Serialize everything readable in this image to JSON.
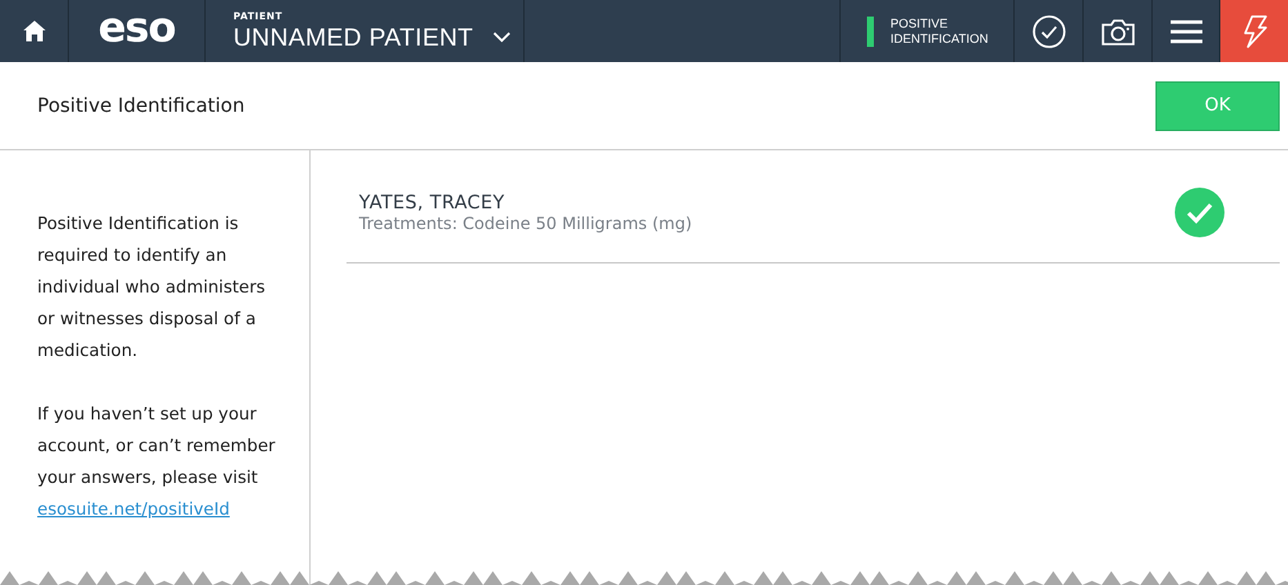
{
  "header": {
    "logo": "eso",
    "patient_label": "PATIENT",
    "patient_name": "UNNAMED PATIENT",
    "status": {
      "label": "POSITIVE IDENTIFICATION",
      "color": "#2ecc71"
    }
  },
  "page": {
    "title": "Positive Identification",
    "ok_button": "OK"
  },
  "sidebar": {
    "paragraphs": [
      "Positive Identification is required to identify an individual who administers or witnesses disposal of a medication.",
      "If you haven’t set up your account, or can’t remember your answers, please visit"
    ],
    "link": "esosuite.net/positiveId"
  },
  "identifications": [
    {
      "name": "YATES, TRACEY",
      "detail": "Treatments: Codeine 50 Milligrams (mg)",
      "verified": true
    }
  ]
}
